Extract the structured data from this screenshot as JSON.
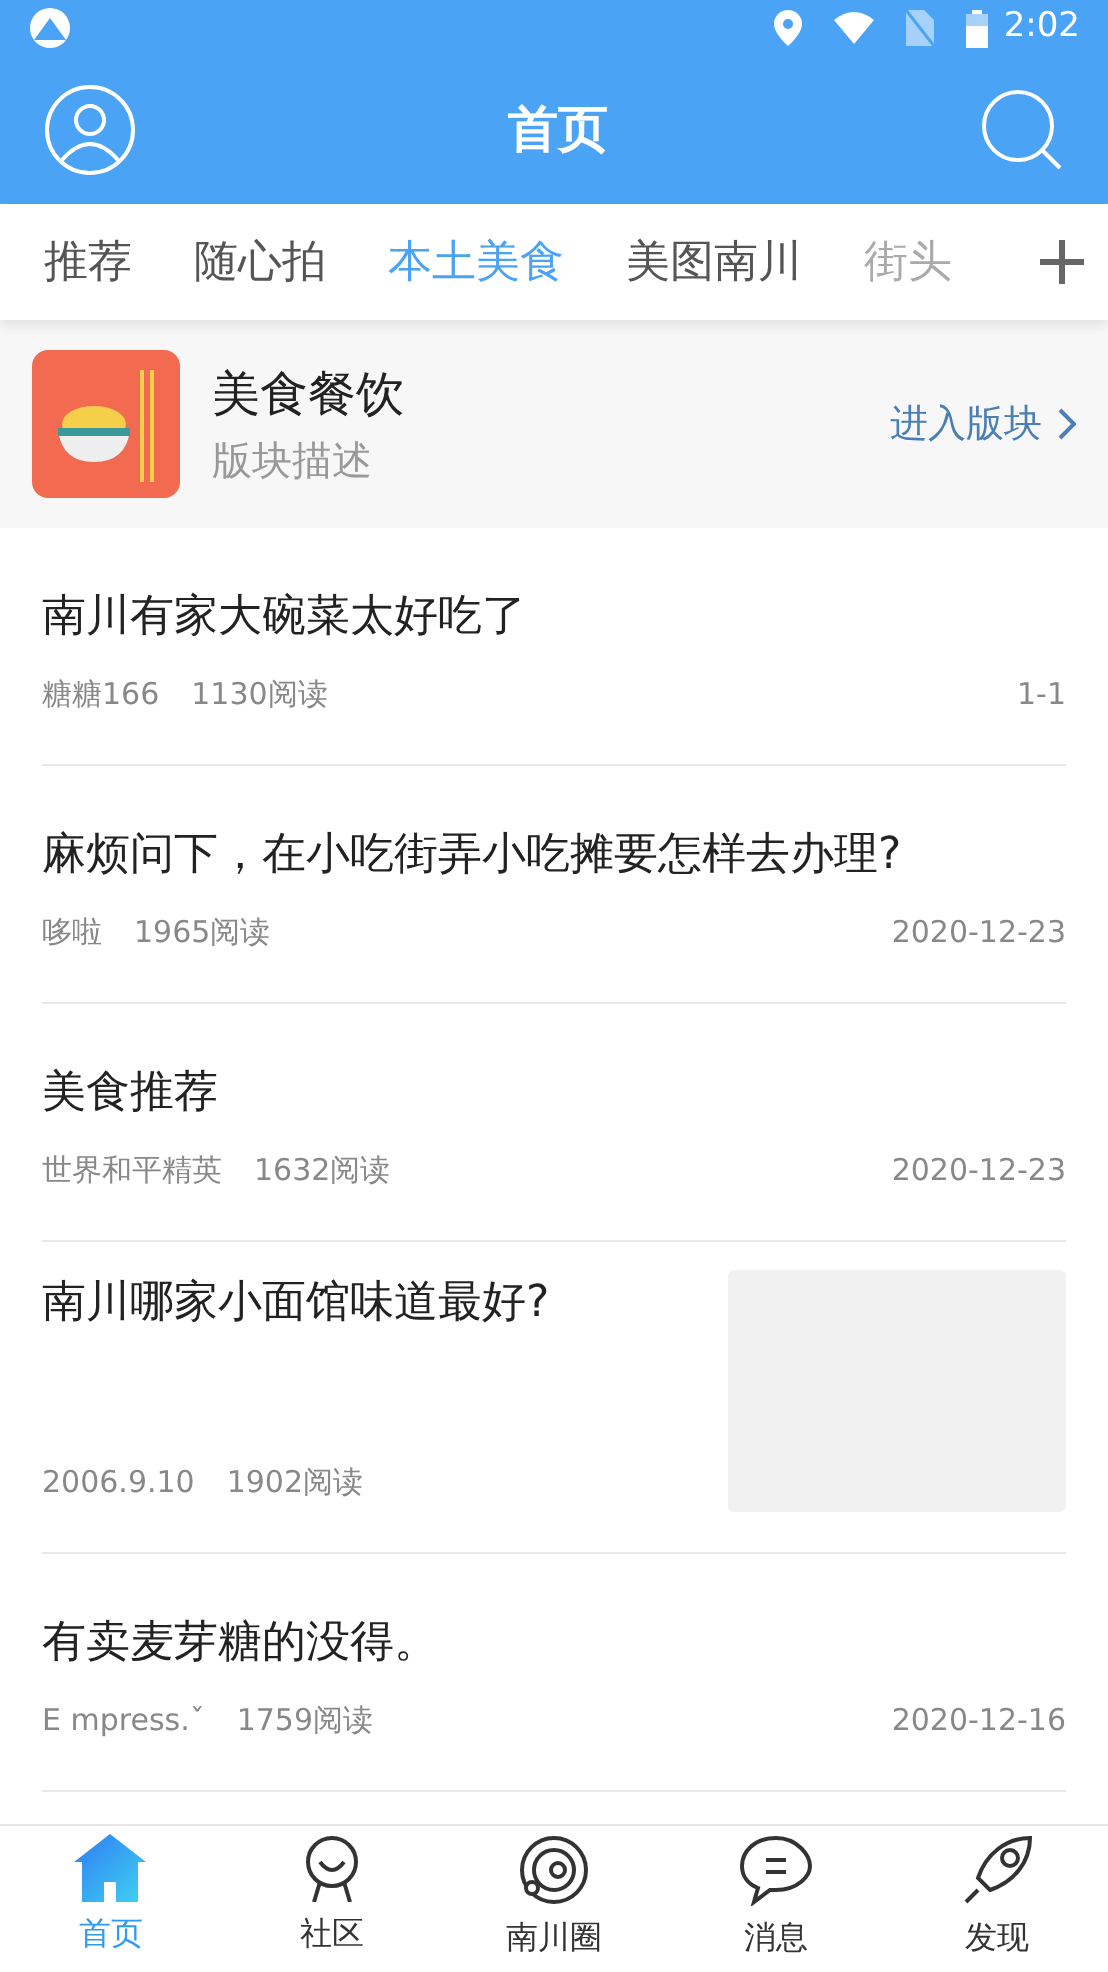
{
  "status_bar": {
    "time": "2:02"
  },
  "header": {
    "title": "首页"
  },
  "tabs": [
    {
      "label": "推荐",
      "selected": false
    },
    {
      "label": "随心拍",
      "selected": false
    },
    {
      "label": "本土美食",
      "selected": true
    },
    {
      "label": "美图南川",
      "selected": false
    },
    {
      "label": "街头",
      "selected": false
    }
  ],
  "board": {
    "name": "美食餐饮",
    "description": "版块描述",
    "enter": "进入版块"
  },
  "posts": [
    {
      "title": "南川有家大碗菜太好吃了",
      "author": "糖糖166",
      "reads": "1130阅读",
      "date": "1-1",
      "thumbnail": false
    },
    {
      "title": "麻烦问下，在小吃街弄小吃摊要怎样去办理?",
      "author": "哆啦",
      "reads": "1965阅读",
      "date": "2020-12-23",
      "thumbnail": false
    },
    {
      "title": "美食推荐",
      "author": "世界和平精英",
      "reads": "1632阅读",
      "date": "2020-12-23",
      "thumbnail": false
    },
    {
      "title": "南川哪家小面馆味道最好?",
      "author": "2006.9.10",
      "reads": "1902阅读",
      "thumbnail": true
    },
    {
      "title": "有卖麦芽糖的没得。",
      "author": "E mpress.ˇ",
      "reads": "1759阅读",
      "date": "2020-12-16",
      "thumbnail": false
    }
  ],
  "bottom_nav": [
    {
      "label": "首页",
      "selected": true
    },
    {
      "label": "社区",
      "selected": false
    },
    {
      "label": "南川圈",
      "selected": false
    },
    {
      "label": "消息",
      "selected": false
    },
    {
      "label": "发现",
      "selected": false
    }
  ]
}
